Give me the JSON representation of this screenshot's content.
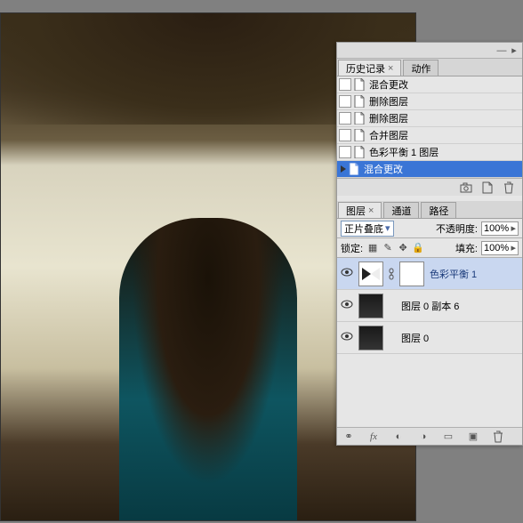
{
  "history_panel": {
    "tabs": [
      {
        "label": "历史记录",
        "active": true
      },
      {
        "label": "动作",
        "active": false
      }
    ],
    "items": [
      {
        "label": "混合更改"
      },
      {
        "label": "删除图层"
      },
      {
        "label": "删除图层"
      },
      {
        "label": "合并图层"
      },
      {
        "label": "色彩平衡 1 图层"
      },
      {
        "label": "混合更改",
        "selected": true,
        "current": true
      }
    ],
    "footer_icons": [
      "camera-icon",
      "new-doc-icon",
      "trash-icon"
    ]
  },
  "layers_panel": {
    "tabs": [
      {
        "label": "图层",
        "active": true
      },
      {
        "label": "通道",
        "active": false
      },
      {
        "label": "路径",
        "active": false
      }
    ],
    "blend_mode": "正片叠底",
    "opacity_label": "不透明度:",
    "opacity_value": "100%",
    "lock_label": "锁定:",
    "fill_label": "填充:",
    "fill_value": "100%",
    "layers": [
      {
        "name": "色彩平衡 1",
        "type": "adjustment",
        "selected": true,
        "linked": true
      },
      {
        "name": "图层 0 副本 6",
        "type": "image"
      },
      {
        "name": "图层 0",
        "type": "image"
      }
    ],
    "footer_icons": [
      "link-icon",
      "fx-icon",
      "mask-icon",
      "adjust-icon",
      "folder-icon",
      "new-layer-icon",
      "trash-icon"
    ]
  }
}
